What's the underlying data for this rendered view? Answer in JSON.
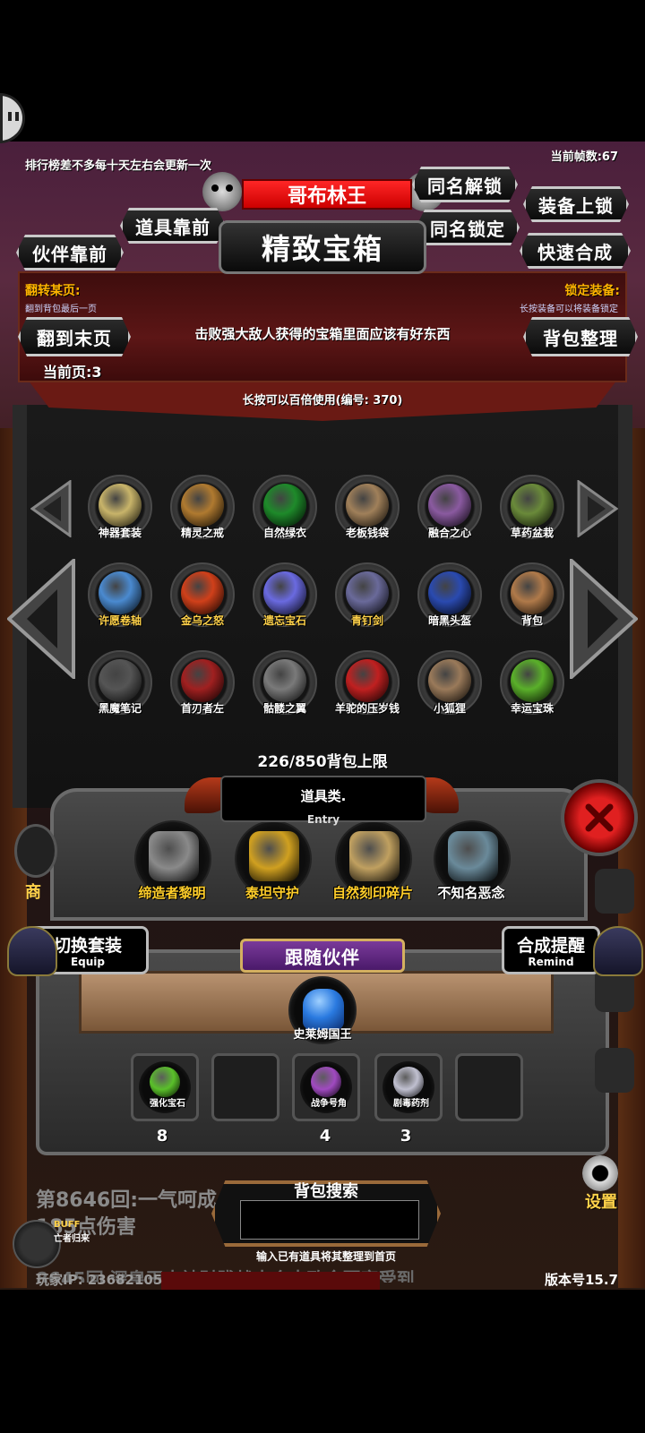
{
  "topbar": {
    "ticker": "排行榜差不多每十天左右会更新一次",
    "fps": "当前帧数:67"
  },
  "header": {
    "boss_name": "哥布林王",
    "chest_title": "精致宝箱"
  },
  "buttons": {
    "same_name_unlock": "同名解锁",
    "same_name_lock": "同名锁定",
    "equip_lock": "装备上锁",
    "quick_merge": "快速合成",
    "item_front": "道具靠前",
    "partner_front": "伙伴靠前",
    "to_last_page": "翻到末页",
    "sort_bag": "背包整理"
  },
  "info": {
    "flip_label": "翻转某页:",
    "flip_hint": "翻到背包最后一页",
    "lock_label": "锁定装备:",
    "lock_hint": "长按装备可以将装备锁定",
    "description": "击败强大敌人获得的宝箱里面应该有好东西",
    "current_page": "当前页:3",
    "use_hint": "长按可以百倍使用(编号:  370)"
  },
  "grid_items": [
    {
      "name": "神器套装",
      "icon": "armor-set-icon",
      "color": "#c8b46a",
      "gold": false
    },
    {
      "name": "精灵之戒",
      "icon": "ring-icon",
      "color": "#b07a30",
      "gold": false
    },
    {
      "name": "自然绿衣",
      "icon": "green-robe-icon",
      "color": "#1e8a2a",
      "gold": false
    },
    {
      "name": "老板钱袋",
      "icon": "money-bag-icon",
      "color": "#a0805a",
      "gold": false
    },
    {
      "name": "融合之心",
      "icon": "fusion-heart-icon",
      "color": "#8a5aa0",
      "gold": false
    },
    {
      "name": "草药盆栽",
      "icon": "herb-pot-icon",
      "color": "#6a8a3a",
      "gold": false
    },
    {
      "name": "许愿卷轴",
      "icon": "scroll-icon",
      "color": "#4a8ad0",
      "gold": true
    },
    {
      "name": "金乌之怒",
      "icon": "fire-bird-icon",
      "color": "#d0401a",
      "gold": true
    },
    {
      "name": "遗忘宝石",
      "icon": "crystal-icon",
      "color": "#6a6ae0",
      "gold": true
    },
    {
      "name": "青钉剑",
      "icon": "sword-icon",
      "color": "#6a6a9a",
      "gold": true
    },
    {
      "name": "暗黑头盔",
      "icon": "dark-helmet-icon",
      "color": "#2a4ab0",
      "gold": false
    },
    {
      "name": "背包",
      "icon": "backpack-icon",
      "color": "#b07a4a",
      "gold": false
    },
    {
      "name": "黑魔笔记",
      "icon": "black-book-icon",
      "color": "#555555",
      "gold": false
    },
    {
      "name": "首刃者左",
      "icon": "blade-icon",
      "color": "#a02020",
      "gold": false
    },
    {
      "name": "骷髅之翼",
      "icon": "bone-wings-icon",
      "color": "#7a7a7a",
      "gold": false
    },
    {
      "name": "羊驼的压岁钱",
      "icon": "red-envelope-icon",
      "color": "#c02020",
      "gold": false
    },
    {
      "name": "小狐狸",
      "icon": "fox-icon",
      "color": "#9a7a5a",
      "gold": false
    },
    {
      "name": "幸运宝珠",
      "icon": "lucky-orb-icon",
      "color": "#5ab02a",
      "gold": false
    }
  ],
  "capacity": "226/850背包上限",
  "category": {
    "label": "道具类.",
    "entry": "Entry"
  },
  "equipped": [
    {
      "name": "缔造者黎明",
      "icon": "sword-dawn-icon",
      "color": "#8a8a8a",
      "gold": true
    },
    {
      "name": "泰坦守护",
      "icon": "titan-guard-icon",
      "color": "#d0a020",
      "gold": true
    },
    {
      "name": "自然刻印碎片",
      "icon": "rune-fragment-icon",
      "color": "#c0a060",
      "gold": true
    },
    {
      "name": "不知名恶念",
      "icon": "ghost-icon",
      "color": "#6a8a9a",
      "gold": false
    }
  ],
  "switch_set": {
    "main": "切换套装",
    "sub": "Equip"
  },
  "merge_remind": {
    "main": "合成提醒",
    "sub": "Remind"
  },
  "companion": {
    "header": "跟随伙伴",
    "name": "史莱姆国王",
    "icon": "slime-king-icon",
    "color": "#2a7ae0"
  },
  "inventory": [
    {
      "name": "强化宝石",
      "count": "8",
      "icon": "gem-icon",
      "color": "#5ac02a"
    },
    {
      "name": "",
      "count": "",
      "icon": "",
      "color": ""
    },
    {
      "name": "战争号角",
      "count": "4",
      "icon": "war-horn-icon",
      "color": "#a04ac0"
    },
    {
      "name": "剧毒药剂",
      "count": "3",
      "icon": "potion-icon",
      "color": "#c0c0d0"
    },
    {
      "name": "",
      "count": "",
      "icon": "",
      "color": ""
    }
  ],
  "battle_log": {
    "line1": "第8646回:一气呵成            战士造成6",
    "line2": "185点伤害",
    "line3": "8645回 深皇王大神財賤战士会中致命要害受到"
  },
  "search": {
    "title": "背包搜索",
    "hint": "输入已有道具将其整理到首页"
  },
  "settings_label": "设置",
  "shop_label": "商",
  "buff": {
    "label": "BUFF",
    "sub": "亡者归来"
  },
  "player_ip": "玩家IP: 23682105",
  "version": "版本号15.7"
}
